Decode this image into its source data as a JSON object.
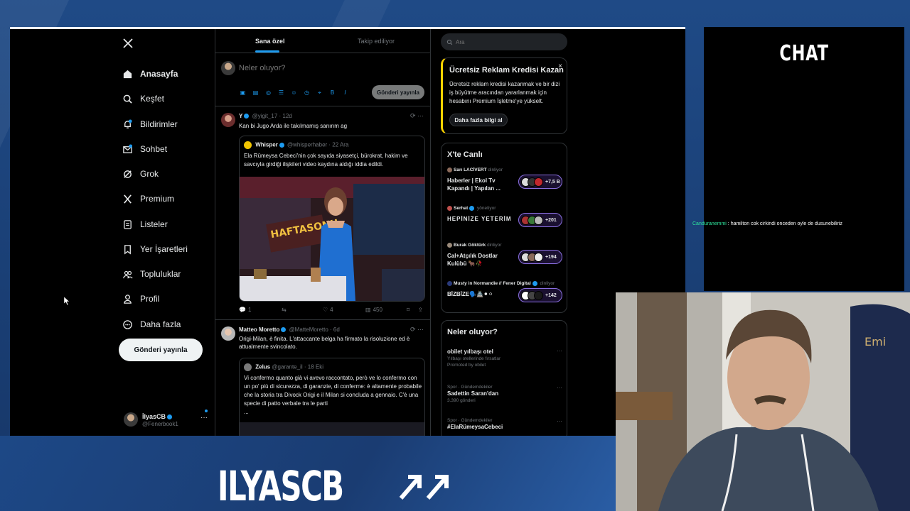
{
  "stream": {
    "brand_name": "ILYASCB",
    "chat_title": "CHAT",
    "chat_messages": [
      {
        "user": "Canduranemmi",
        "text": " : hamilton cok cirkindi onceden oyle de dusunebiliriz"
      }
    ]
  },
  "nav": {
    "logo": "x-logo-icon",
    "items": [
      {
        "label": "Anasayfa",
        "icon": "home-icon",
        "active": true
      },
      {
        "label": "Keşfet",
        "icon": "search-icon"
      },
      {
        "label": "Bildirimler",
        "icon": "bell-icon"
      },
      {
        "label": "Sohbet",
        "icon": "envelope-icon"
      },
      {
        "label": "Grok",
        "icon": "grok-icon"
      },
      {
        "label": "Premium",
        "icon": "x-logo-icon"
      },
      {
        "label": "Listeler",
        "icon": "list-icon"
      },
      {
        "label": "Yer İşaretleri",
        "icon": "bookmark-icon"
      },
      {
        "label": "Topluluklar",
        "icon": "people-icon"
      },
      {
        "label": "Profil",
        "icon": "person-icon"
      },
      {
        "label": "Daha fazla",
        "icon": "more-circle-icon"
      }
    ],
    "post_button": "Gönderi yayınla",
    "user": {
      "name": "İlyasCB",
      "handle": "@Fenerbook1",
      "more": "···"
    }
  },
  "feed": {
    "tabs": [
      "Sana özel",
      "Takip ediliyor"
    ],
    "compose_placeholder": "Neler oluyor?",
    "compose_post": "Gönderi yayınla",
    "tweets": [
      {
        "name": "Y",
        "meta": "@yigit_17 · 12d",
        "text": "Kan bi Jugo Arda ile takılmamış sanırım ag",
        "quote": {
          "name": "Whisper",
          "meta": "@whisperhaber · 22 Ara",
          "text": "Ela Rümeysa Cebeci'nin çok sayıda siyasetçi, bürokrat, hakim ve savcıyla girdiği ilişkileri video kaydına aldığı iddia edildi.",
          "image_caption": "HAFTASONU"
        },
        "actions": {
          "replies": "1",
          "retweets": "",
          "likes": "4",
          "views": "450"
        }
      },
      {
        "name": "Matteo Moretto",
        "meta": "@MatteMoretto · 6d",
        "text": "Origi-Milan, è finita. L'attaccante belga ha firmato la risoluzione ed è attualmente svincolato.",
        "quote": {
          "name": "Zelus",
          "meta": "@garante_il · 18 Eki",
          "text": "Vi confermo quanto già vi avevo raccontato, però ve lo confermo con un po' più di sicurezza, di garanzie, di conferme: è altamente probabile che la storia tra Divock Origi e il Milan si concluda a gennaio. C'è una specie di patto verbale tra le parti",
          "ellipsis": "..."
        }
      }
    ]
  },
  "right": {
    "search_placeholder": "Ara",
    "promo": {
      "title": "Ücretsiz Reklam Kredisi Kazan",
      "close": "×",
      "text": "Ücretsiz reklam kredisi kazanmak ve bir dizi iş büyütme aracından yararlanmak için hesabını Premium İşletme'ye yükselt.",
      "button": "Daha fazla bilgi al"
    },
    "live": {
      "title": "X'te Canlı",
      "items": [
        {
          "host": "Sarı LACİVERT",
          "role": "dinliyor",
          "title": "Haberler | Ekol Tv Kapandı | Yapılan ...",
          "count": "+7,5 B"
        },
        {
          "host": "Serhat",
          "role": "yönetiyor",
          "title": "HEPİNİZE YETERİM",
          "count": "+201"
        },
        {
          "host": "Burak Göktürk",
          "role": "dinliyor",
          "title": "Cal+Atçılık Dostlar Kulübü 🐂🥀",
          "count": "+194"
        },
        {
          "host": "Musty in Normandie // Fener Digital",
          "role": "dinliyor",
          "title": "BİZBİZE🗣️🏯⚫⚪",
          "count": "+142"
        }
      ]
    },
    "trends": {
      "title": "Neler oluyor?",
      "items": [
        {
          "category": "",
          "name": "obilet yılbaşı otel",
          "sub": "Yılbaşı otellerinde fırsatlar",
          "promoted": "Promoted by obilet"
        },
        {
          "category": "Spor · Gündemdekiler",
          "name": "Sadettin Saran'dan",
          "sub": "3.390 gönderi"
        },
        {
          "category": "Spor · Gündemdekiler",
          "name": "#ElaRümeysaCebeci",
          "sub": ""
        }
      ],
      "more": "···"
    }
  },
  "colors": {
    "accent": "#1d9bf0",
    "promo_border": "#ffd400",
    "live_pill": "#8a6fe0",
    "chat_user": "#2ee59d"
  }
}
